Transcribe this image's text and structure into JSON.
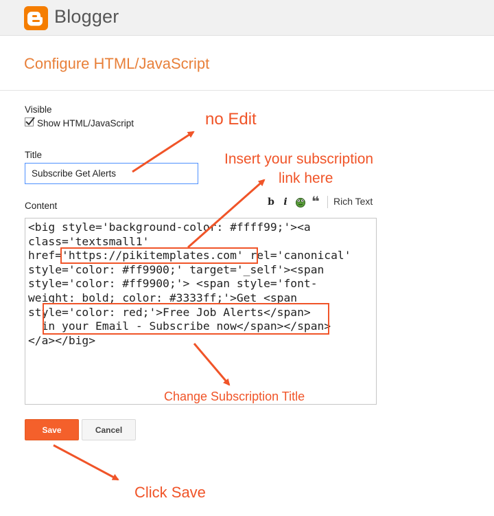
{
  "app": {
    "brand": "Blogger",
    "brand_color": "#f57d00"
  },
  "page": {
    "title": "Configure HTML/JavaScript",
    "title_color": "#e8803a"
  },
  "visible": {
    "label": "Visible",
    "checkbox_label": "Show HTML/JavaScript",
    "checked": true
  },
  "title_field": {
    "label": "Title",
    "value": "Subscribe Get Alerts"
  },
  "content": {
    "label": "Content",
    "toolbar": {
      "bold": "b",
      "italic": "i",
      "quote": "❝",
      "rich_text": "Rich Text"
    },
    "code_lines": [
      "<big style='background-color: #ffff99;'><a",
      "class='textsmall1'",
      "href='https://pikitemplates.com' rel='canonical'",
      "style='color: #ff9900;' target='_self'><span",
      "style='color: #ff9900;'> <span style='font-",
      "weight: bold; color: #3333ff;'>Get <span",
      "style='color: red;'>Free Job Alerts</span>",
      "  in your Email - Subscribe now</span></span>",
      "</a></big>"
    ]
  },
  "buttons": {
    "save": "Save",
    "cancel": "Cancel",
    "save_color": "#f4602b"
  },
  "annotations": {
    "no_edit": "no Edit",
    "insert_link_1": "Insert your subscription",
    "insert_link_2": "link here",
    "change_title": "Change Subscription Title",
    "click_save": "Click Save",
    "color": "#f05428"
  }
}
